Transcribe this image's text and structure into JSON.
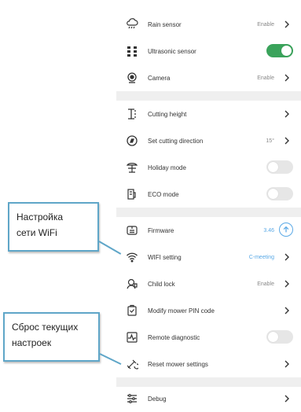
{
  "settings": {
    "rain_sensor": {
      "label": "Rain sensor",
      "value": "Enable"
    },
    "ultrasonic_sensor": {
      "label": "Ultrasonic sensor",
      "toggle": "on"
    },
    "camera": {
      "label": "Camera",
      "value": "Enable"
    },
    "cutting_height": {
      "label": "Cutting height"
    },
    "set_cutting_direction": {
      "label": "Set cutting direction",
      "value": "15°"
    },
    "holiday_mode": {
      "label": "Holiday mode",
      "toggle": "off"
    },
    "eco_mode": {
      "label": "ECO mode",
      "toggle": "off"
    },
    "firmware": {
      "label": "Firmware",
      "value": "3.46"
    },
    "wifi_setting": {
      "label": "WIFI setting",
      "value": "C-meeting"
    },
    "child_lock": {
      "label": "Child lock",
      "value": "Enable"
    },
    "modify_pin": {
      "label": "Modify mower PIN code"
    },
    "remote_diagnostic": {
      "label": "Remote diagnostic",
      "toggle": "off"
    },
    "reset_settings": {
      "label": "Reset mower settings"
    },
    "debug": {
      "label": "Debug"
    }
  },
  "annotations": {
    "wifi_callout": {
      "line1": "Настройка",
      "line2": "сети WiFi"
    },
    "reset_callout": {
      "line1": "Сброс текущих",
      "line2": "настроек"
    }
  },
  "colors": {
    "toggle_on": "#3aa35b",
    "toggle_off": "#e6e6e6",
    "callout_border": "#5fa6c8",
    "firmware_badge": "#5aa9e6"
  }
}
